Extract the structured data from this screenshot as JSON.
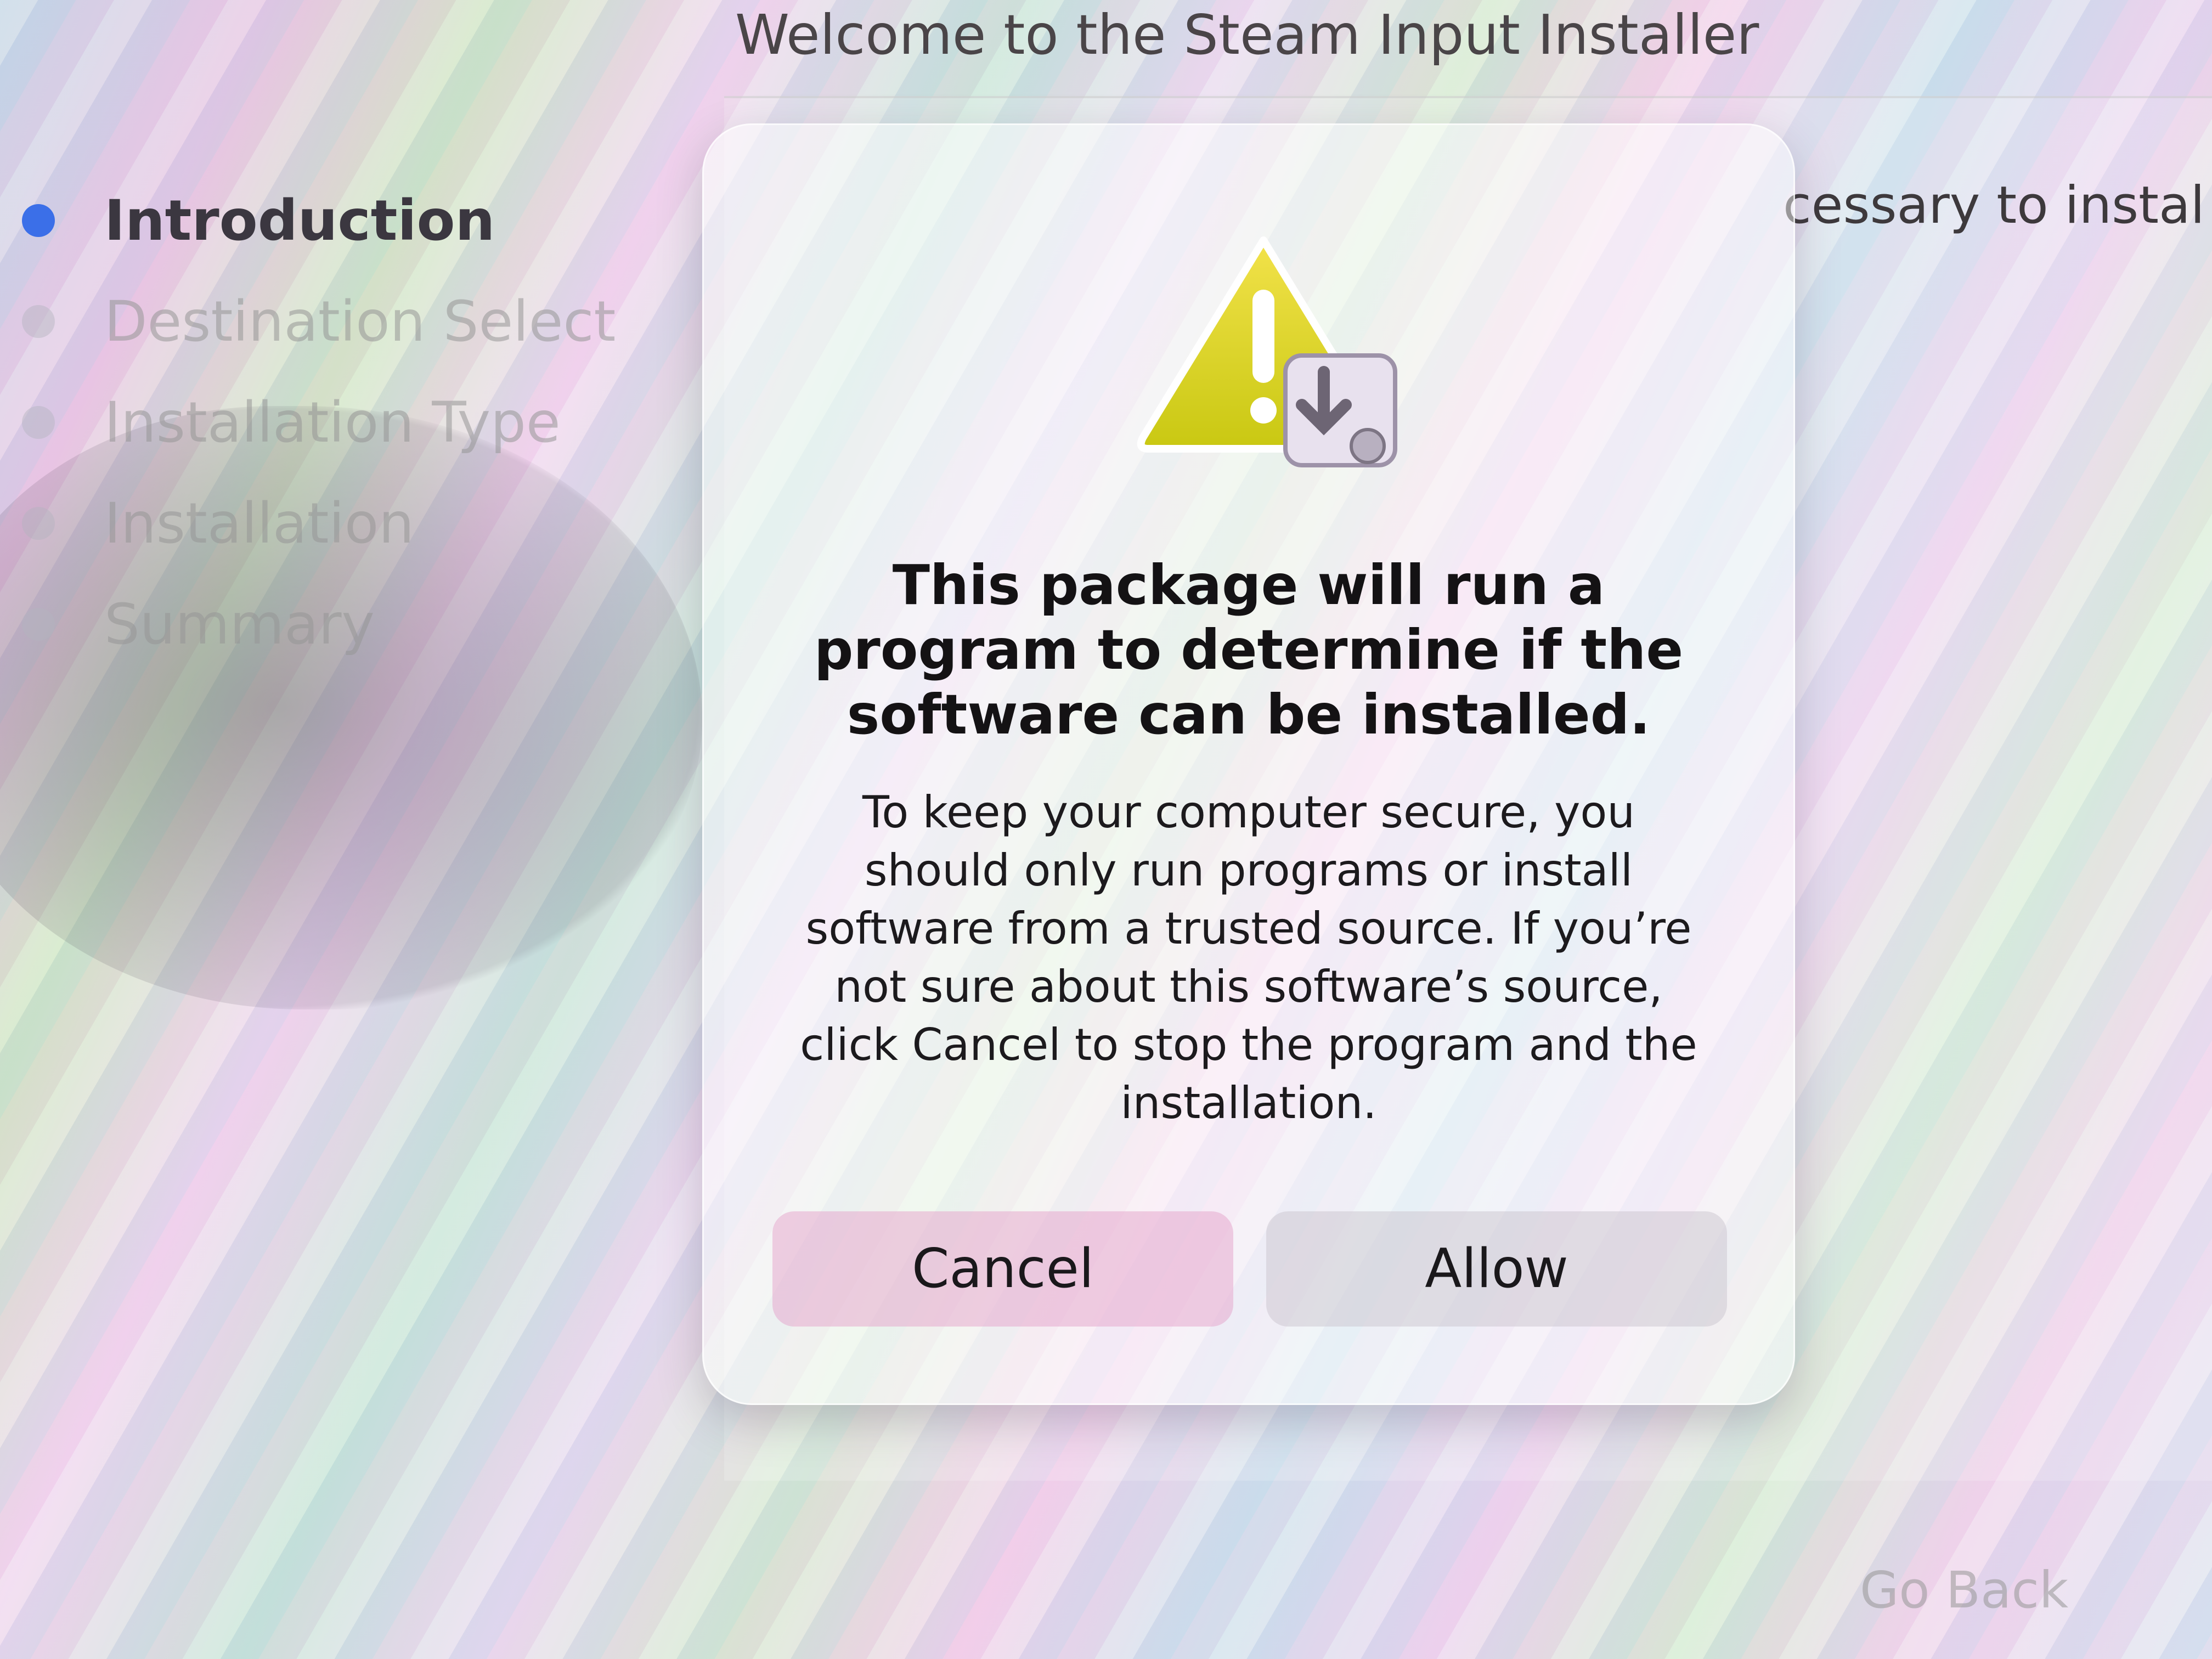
{
  "window": {
    "title": "Welcome to the Steam Input Installer"
  },
  "sidebar": {
    "steps": [
      {
        "label": "Introduction",
        "state": "active"
      },
      {
        "label": "Destination Select",
        "state": "inactive"
      },
      {
        "label": "Installation Type",
        "state": "inactive"
      },
      {
        "label": "Installation",
        "state": "inactive"
      },
      {
        "label": "Summary",
        "state": "inactive"
      }
    ]
  },
  "content": {
    "partial_text": "cessary to instal"
  },
  "dialog": {
    "icon": "warning-installer-icon",
    "title": "This package will run a program to determine if the software can be installed.",
    "body": "To keep your computer secure, you should only run programs or install software from a trusted source. If you’re not sure about this software’s source, click Cancel to stop the program and the installation.",
    "cancel_label": "Cancel",
    "allow_label": "Allow"
  },
  "footer": {
    "go_back_label": "Go Back"
  },
  "colors": {
    "active_step": "#3b6fe8",
    "warning_yellow": "#e6d21a"
  }
}
